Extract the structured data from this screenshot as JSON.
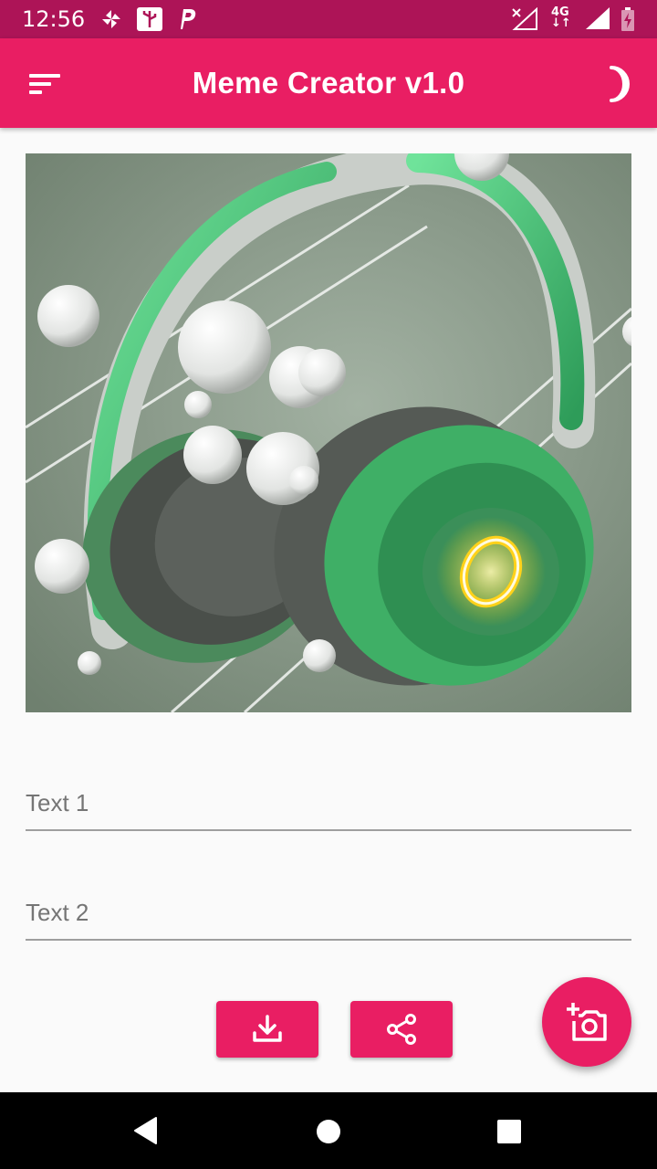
{
  "status_bar": {
    "time": "12:56",
    "network": "4G",
    "icons": [
      "pinwheel-icon",
      "usb-icon",
      "parking-p-icon",
      "no-wifi-signal-icon",
      "cell-signal-icon",
      "battery-charging-icon"
    ]
  },
  "app_bar": {
    "title": "Meme Creator v1.0",
    "menu_icon": "sort-menu-icon",
    "theme_icon": "crescent-moon-icon"
  },
  "meme_image": {
    "description_icon": "headphones-photo",
    "colors": {
      "background": "#8a9c8a",
      "accent": "#3fbf6f",
      "ring": "#f5c400"
    }
  },
  "inputs": {
    "text1_placeholder": "Text 1",
    "text1_value": "",
    "text2_placeholder": "Text 2",
    "text2_value": ""
  },
  "actions": {
    "download_icon": "download-icon",
    "share_icon": "share-icon",
    "add_photo_icon": "add-photo-camera-icon"
  },
  "nav_bar": {
    "icons": [
      "back-triangle-icon",
      "home-circle-icon",
      "recents-square-icon"
    ]
  },
  "colors": {
    "primary": "#e91e63",
    "primary_dark": "#ad1457",
    "background": "#fafafa"
  }
}
